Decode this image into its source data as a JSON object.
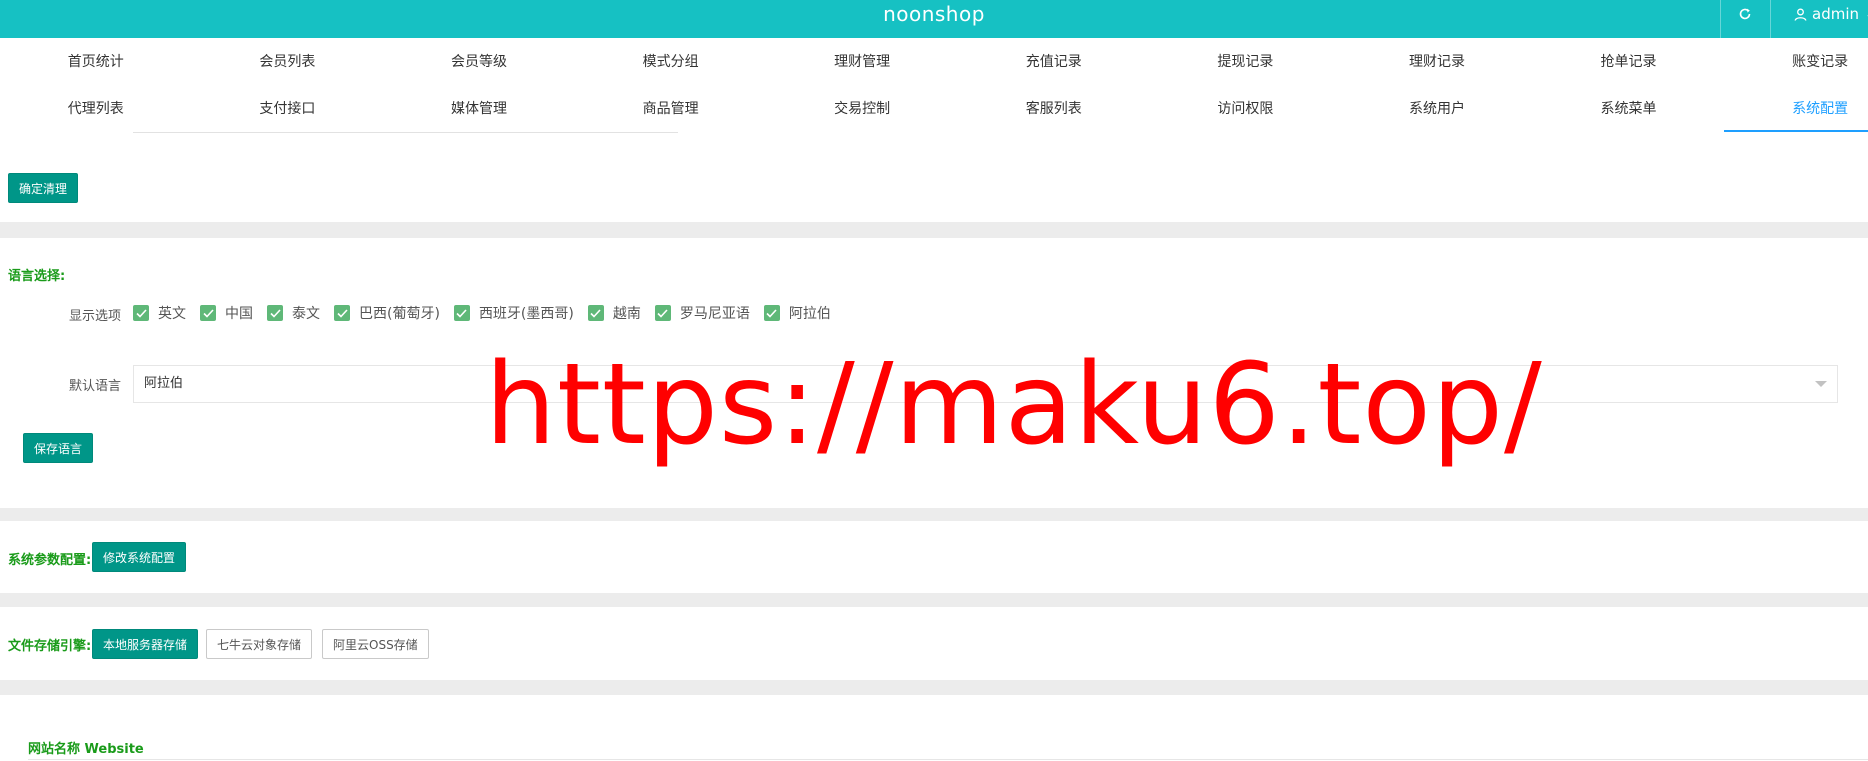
{
  "app": {
    "title": "noonshop",
    "user": "admin",
    "accent": "#16c1c3",
    "primary_button": "#009688"
  },
  "nav": {
    "row1": [
      "首页统计",
      "会员列表",
      "会员等级",
      "模式分组",
      "理财管理",
      "充值记录",
      "提现记录",
      "理财记录",
      "抢单记录",
      "账变记录"
    ],
    "row2": [
      "代理列表",
      "支付接口",
      "媒体管理",
      "商品管理",
      "交易控制",
      "客服列表",
      "访问权限",
      "系统用户",
      "系统菜单",
      "系统配置"
    ],
    "active": "系统配置"
  },
  "clear_section": {
    "confirm_button": "确定清理"
  },
  "language": {
    "heading": "语言选择:",
    "display_label": "显示选项",
    "options": [
      "英文",
      "中国",
      "泰文",
      "巴西(葡萄牙)",
      "西班牙(墨西哥)",
      "越南",
      "罗马尼亚语",
      "阿拉伯"
    ],
    "default_label": "默认语言",
    "default_value": "阿拉伯",
    "save_button": "保存语言"
  },
  "system_params": {
    "heading": "系统参数配置:",
    "edit_button": "修改系统配置"
  },
  "storage": {
    "heading": "文件存储引擎:",
    "options": [
      "本地服务器存储",
      "七牛云对象存储",
      "阿里云OSS存储"
    ],
    "selected": "本地服务器存储"
  },
  "website": {
    "name_label": "网站名称 Website"
  },
  "watermark": "https://maku6.top/"
}
